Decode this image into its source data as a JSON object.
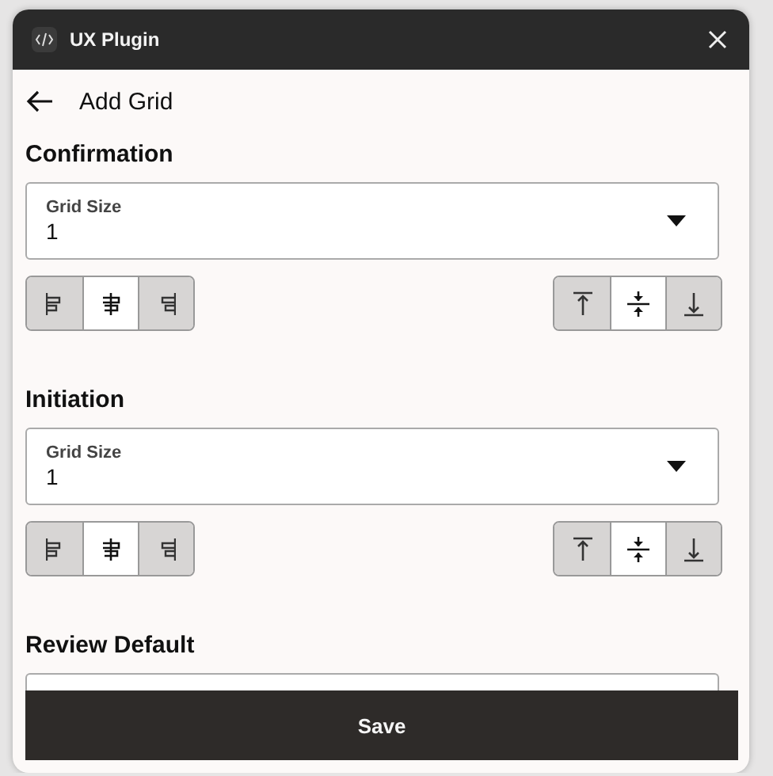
{
  "window": {
    "title": "UX Plugin"
  },
  "header": {
    "title": "Add Grid"
  },
  "sections": [
    {
      "kind": "full",
      "title": "Confirmation",
      "select": {
        "label": "Grid Size",
        "value": "1"
      },
      "h_align": [
        {
          "selected": false
        },
        {
          "selected": true
        },
        {
          "selected": false
        }
      ],
      "v_align": [
        {
          "selected": false
        },
        {
          "selected": true
        },
        {
          "selected": false
        }
      ]
    },
    {
      "kind": "full",
      "title": "Initiation",
      "select": {
        "label": "Grid Size",
        "value": "1"
      },
      "h_align": [
        {
          "selected": false
        },
        {
          "selected": true
        },
        {
          "selected": false
        }
      ],
      "v_align": [
        {
          "selected": false
        },
        {
          "selected": true
        },
        {
          "selected": false
        }
      ]
    },
    {
      "kind": "cut",
      "title": "Review Default"
    }
  ],
  "save_button": {
    "label": "Save"
  }
}
